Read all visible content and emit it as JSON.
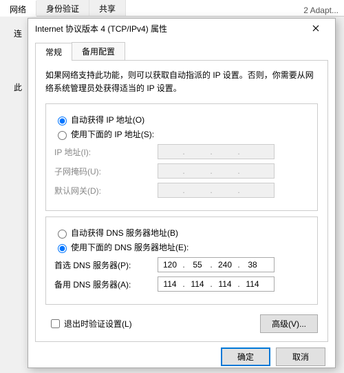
{
  "background": {
    "tabs": [
      "网络",
      "身份验证",
      "共享"
    ],
    "adapterFragment": "2 Adapt...",
    "connLabel": "连",
    "thisLabel": "此"
  },
  "dialog": {
    "title": "Internet 协议版本 4 (TCP/IPv4) 属性",
    "tabs": {
      "general": "常规",
      "alt": "备用配置"
    },
    "desc": "如果网络支持此功能，则可以获取自动指派的 IP 设置。否则，你需要从网络系统管理员处获得适当的 IP 设置。",
    "ip": {
      "auto": "自动获得 IP 地址(O)",
      "manual": "使用下面的 IP 地址(S):",
      "addrLabel": "IP 地址(I):",
      "maskLabel": "子网掩码(U):",
      "gwLabel": "默认网关(D):"
    },
    "dns": {
      "auto": "自动获得 DNS 服务器地址(B)",
      "manual": "使用下面的 DNS 服务器地址(E):",
      "prefLabel": "首选 DNS 服务器(P):",
      "altLabel": "备用 DNS 服务器(A):",
      "pref": [
        "120",
        "55",
        "240",
        "38"
      ],
      "alt": [
        "114",
        "114",
        "114",
        "114"
      ]
    },
    "validate": "退出时验证设置(L)",
    "advanced": "高级(V)...",
    "ok": "确定",
    "cancel": "取消"
  }
}
